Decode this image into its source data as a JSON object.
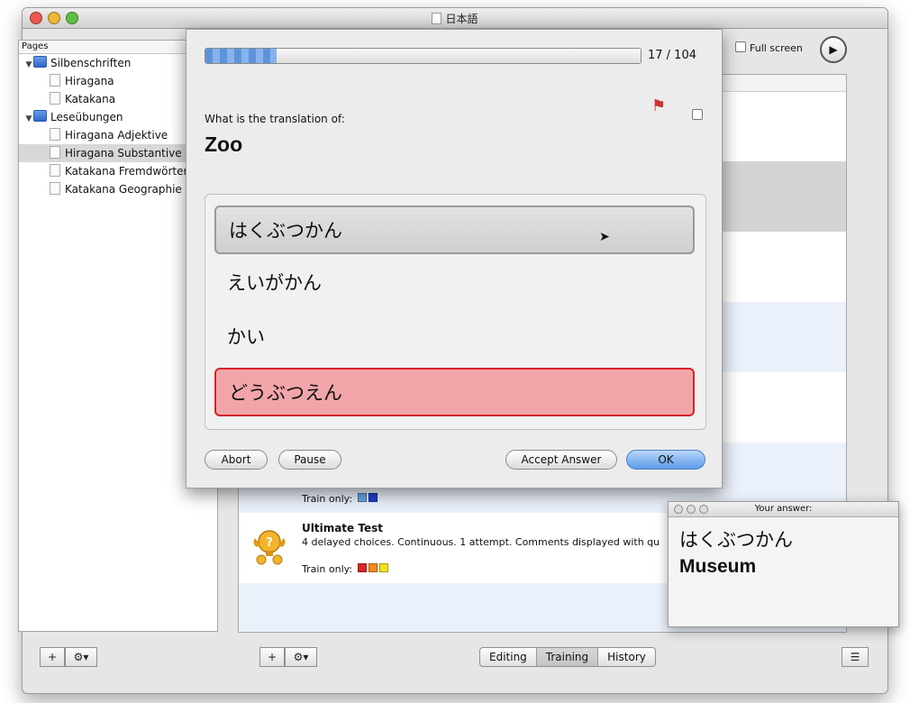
{
  "window": {
    "title": "日本語"
  },
  "sidebar": {
    "header": "Pages",
    "items": [
      {
        "label": "Silbenschriften",
        "level": 0,
        "kind": "folder",
        "expanded": true
      },
      {
        "label": "Hiragana",
        "level": 1,
        "kind": "page"
      },
      {
        "label": "Katakana",
        "level": 1,
        "kind": "page"
      },
      {
        "label": "Leseübungen",
        "level": 0,
        "kind": "folder",
        "expanded": true
      },
      {
        "label": "Hiragana Adjektive",
        "level": 1,
        "kind": "page"
      },
      {
        "label": "Hiragana Substantive",
        "level": 1,
        "kind": "page",
        "selected": true
      },
      {
        "label": "Katakana Fremdwörter",
        "level": 1,
        "kind": "page"
      },
      {
        "label": "Katakana Geographie",
        "level": 1,
        "kind": "page"
      }
    ]
  },
  "toolbar": {
    "fullscreen_label": "Full screen",
    "play_icon": "play-icon"
  },
  "main_list": {
    "last_item": {
      "title": "Ultimate Test",
      "description": "4 delayed choices. Continuous. 1 attempt. Comments displayed with qu",
      "train_label": "Train only:",
      "swatches": [
        "#d62828",
        "#f08a1c",
        "#f2e01a"
      ]
    },
    "prev_item": {
      "train_label": "Train only:",
      "swatches": [
        "#6aa6e8",
        "#1f3fd6"
      ]
    }
  },
  "bottom": {
    "add_label": "+",
    "gear_label": "⚙▾",
    "tabs": [
      "Editing",
      "Training",
      "History"
    ],
    "active_tab": "Training",
    "list_icon": "list-icon"
  },
  "quiz": {
    "progress_current": 17,
    "progress_total": 104,
    "progress_text": "17 / 104",
    "prompt": "What is the translation of:",
    "question": "Zoo",
    "answers": [
      "はくぶつかん",
      "えいがかん",
      "かい",
      "どうぶつえん"
    ],
    "selected_index": 0,
    "correct_index": 3,
    "buttons": {
      "abort": "Abort",
      "pause": "Pause",
      "accept": "Accept Answer",
      "ok": "OK"
    },
    "accent_correct": "#d6232b",
    "accent_ok": "#5d9be8"
  },
  "answer_window": {
    "title": "Your answer:",
    "line1": "はくぶつかん",
    "line2": "Museum"
  }
}
